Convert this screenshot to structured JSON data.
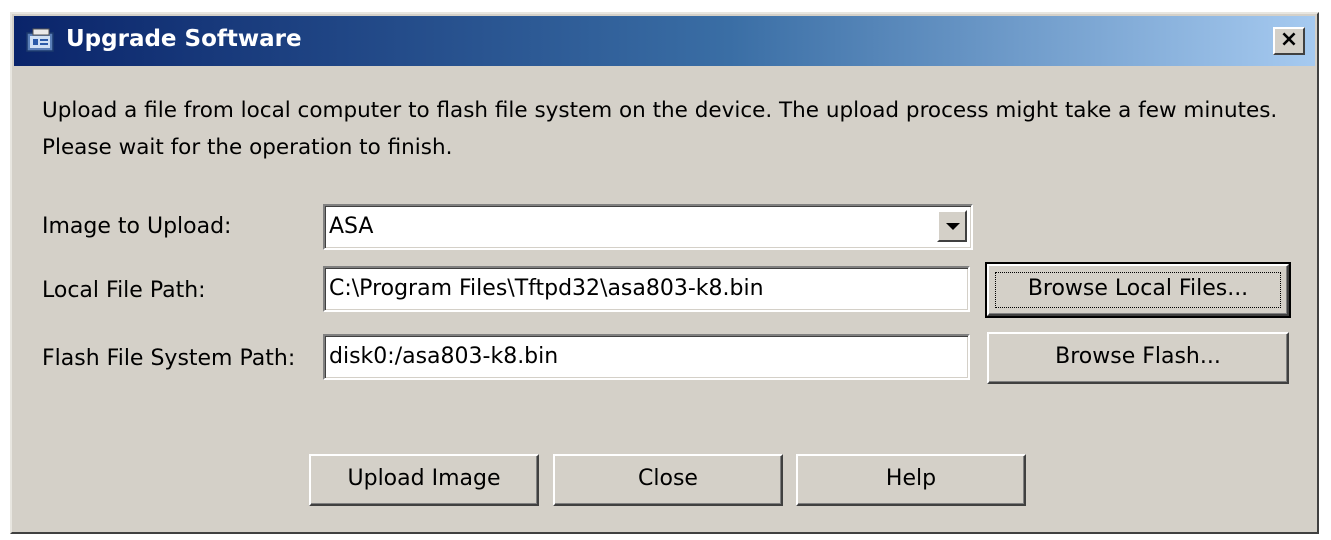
{
  "window": {
    "title": "Upgrade Software",
    "close_label": "×"
  },
  "description": "Upload a file from local computer to flash file system on the device. The upload process might take a few minutes. Please wait for the operation to finish.",
  "form": {
    "image_label": "Image to Upload:",
    "image_value": "ASA",
    "local_label": "Local File Path:",
    "local_value": "C:\\Program Files\\Tftpd32\\asa803-k8.bin",
    "flash_label": "Flash File System Path:",
    "flash_value": "disk0:/asa803-k8.bin"
  },
  "buttons": {
    "browse_local": "Browse Local Files...",
    "browse_flash": "Browse Flash...",
    "upload": "Upload Image",
    "close": "Close",
    "help": "Help"
  },
  "colors": {
    "titlebar_start": "#0a246a",
    "titlebar_end": "#a6caf0",
    "dialog_bg": "#d4d0c8"
  }
}
